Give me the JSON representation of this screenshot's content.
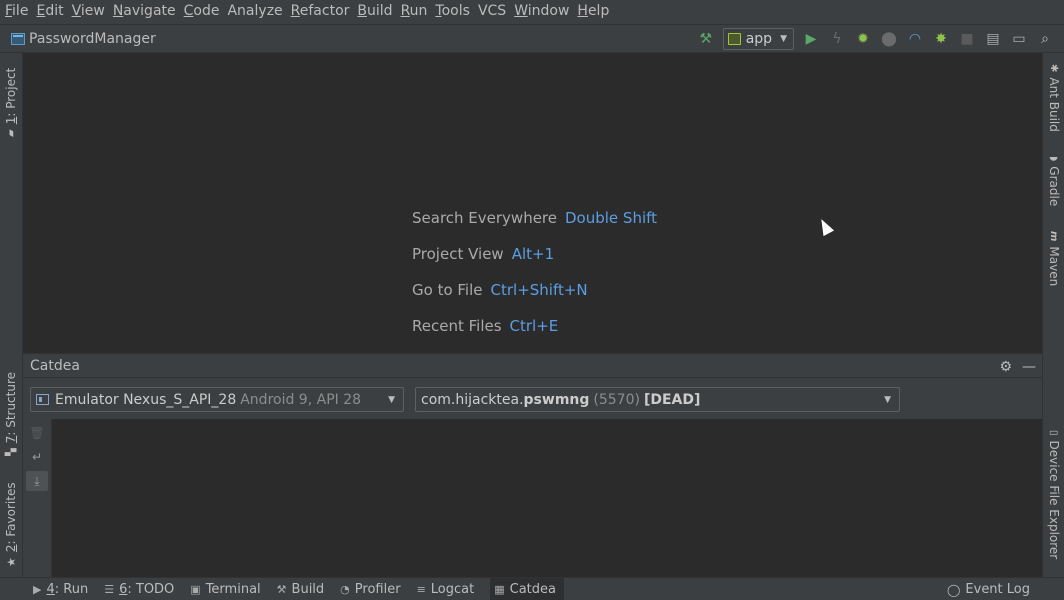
{
  "menu": [
    {
      "mn": "F",
      "rest": "ile"
    },
    {
      "mn": "E",
      "rest": "dit"
    },
    {
      "mn": "V",
      "rest": "iew"
    },
    {
      "mn": "N",
      "rest": "avigate"
    },
    {
      "mn": "C",
      "rest": "ode"
    },
    {
      "mn": "",
      "rest": "Analyze"
    },
    {
      "mn": "R",
      "rest": "efactor"
    },
    {
      "mn": "B",
      "rest": "uild"
    },
    {
      "mn": "R",
      "rest": "un"
    },
    {
      "mn": "T",
      "rest": "ools"
    },
    {
      "mn": "",
      "rest": "VCS"
    },
    {
      "mn": "W",
      "rest": "indow"
    },
    {
      "mn": "H",
      "rest": "elp"
    }
  ],
  "toolbar": {
    "project_name": "PasswordManager",
    "run_config": "app"
  },
  "left_strip": {
    "project_tab": {
      "mn": "1",
      "rest": ": Project"
    },
    "structure_tab": {
      "mn": "7",
      "rest": ": Structure"
    },
    "favorites_tab": {
      "mn": "2",
      "rest": ": Favorites"
    }
  },
  "right_strip": {
    "ant": "Ant Build",
    "gradle": "Gradle",
    "maven": "Maven",
    "device_file_explorer": "Device File Explorer"
  },
  "editor_hints": [
    {
      "action": "Search Everywhere",
      "key": "Double Shift"
    },
    {
      "action": "Project View",
      "key": "Alt+1"
    },
    {
      "action": "Go to File",
      "key": "Ctrl+Shift+N"
    },
    {
      "action": "Recent Files",
      "key": "Ctrl+E"
    }
  ],
  "panel": {
    "title": "Catdea",
    "device": {
      "name": "Emulator Nexus_S_API_28",
      "detail": "Android 9, API 28"
    },
    "process": {
      "prefix": "com.hijacktea.",
      "name": "pswmng",
      "pid": "(5570)",
      "state": "[DEAD]"
    }
  },
  "status_tabs": [
    {
      "mn": "4",
      "rest": ": Run",
      "icon": "▶"
    },
    {
      "mn": "6",
      "rest": ": TODO",
      "icon": "☰"
    },
    {
      "mn": "",
      "rest": "Terminal",
      "icon": "▣"
    },
    {
      "mn": "",
      "rest": "Build",
      "icon": "⚒"
    },
    {
      "mn": "",
      "rest": "Profiler",
      "icon": "◔"
    },
    {
      "mn": "",
      "rest": "Logcat",
      "icon": "≡"
    },
    {
      "mn": "",
      "rest": "Catdea",
      "icon": "▦"
    }
  ],
  "event_log": "Event Log"
}
